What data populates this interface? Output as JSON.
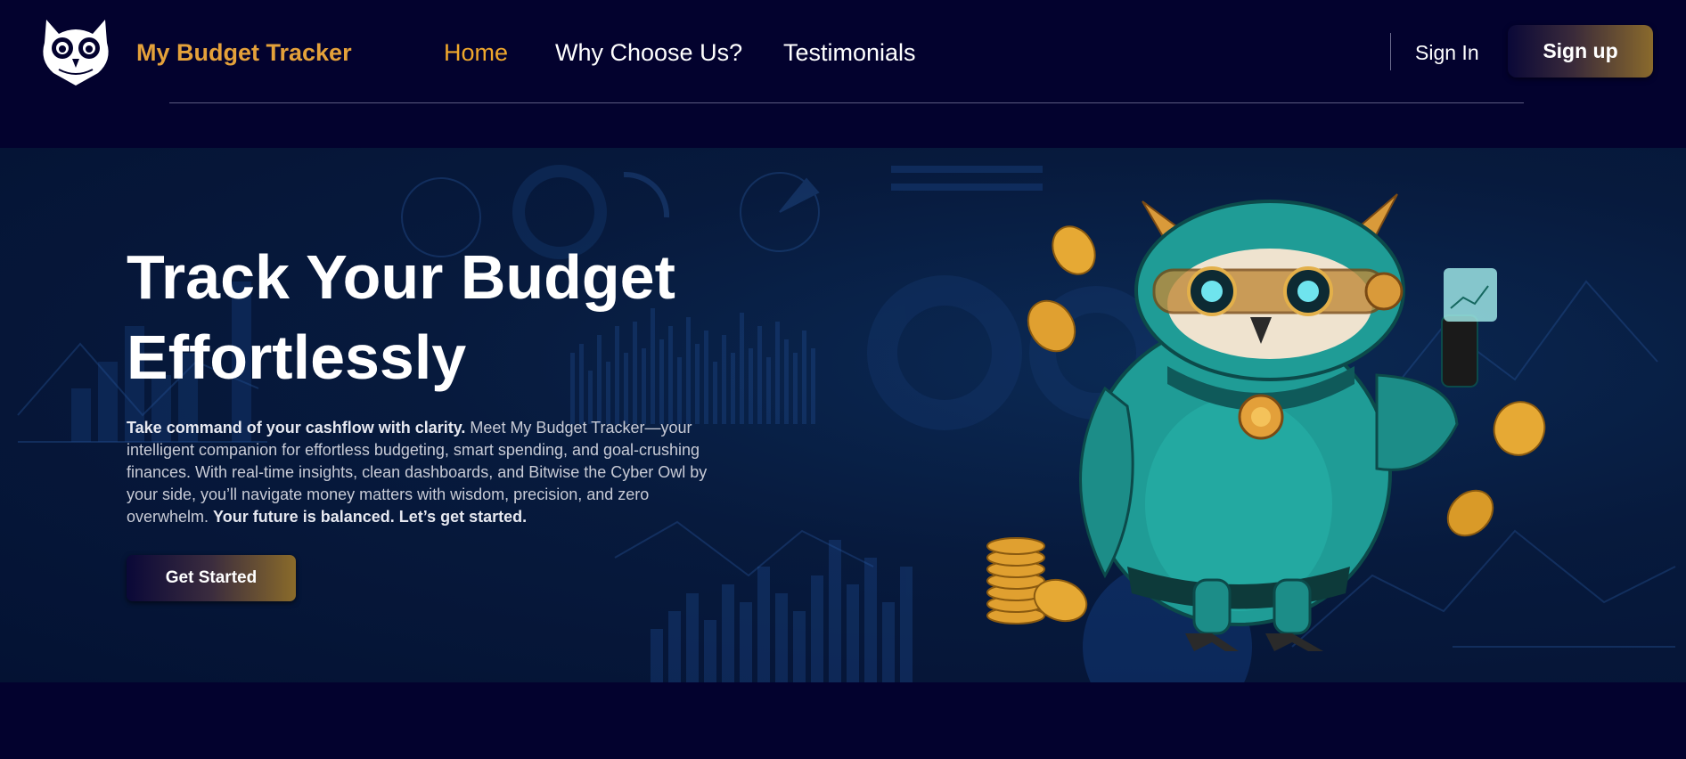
{
  "navbar": {
    "logo_icon": "owl-logo-icon",
    "brand": "My Budget Tracker",
    "links": [
      {
        "label": "Home",
        "active": true
      },
      {
        "label": "Why Choose Us?",
        "active": false
      },
      {
        "label": "Testimonials",
        "active": false
      }
    ],
    "signin_label": "Sign In",
    "signup_label": "Sign up"
  },
  "hero": {
    "title_line1": "Track Your Budget",
    "title_line2": "Effortlessly",
    "desc_lead": "Take command of your cashflow with clarity.",
    "desc_body": " Meet My Budget Tracker—your intelligent companion for effortless budgeting, smart spending, and goal-crushing finances. With real-time insights, clean dashboards, and Bitwise the Cyber Owl by your side, you’ll navigate money matters with wisdom, precision, and zero overwhelm. ",
    "desc_close": "Your future is balanced. Let’s get started.",
    "cta_label": "Get Started",
    "illustration_icon": "cyber-owl-illustration"
  },
  "colors": {
    "background": "#03022e",
    "brand": "#e4a13a",
    "active_link": "#f0a82c",
    "hero_bg": "#071a3d",
    "owl_teal": "#1f9c96",
    "gold": "#e0a030"
  }
}
